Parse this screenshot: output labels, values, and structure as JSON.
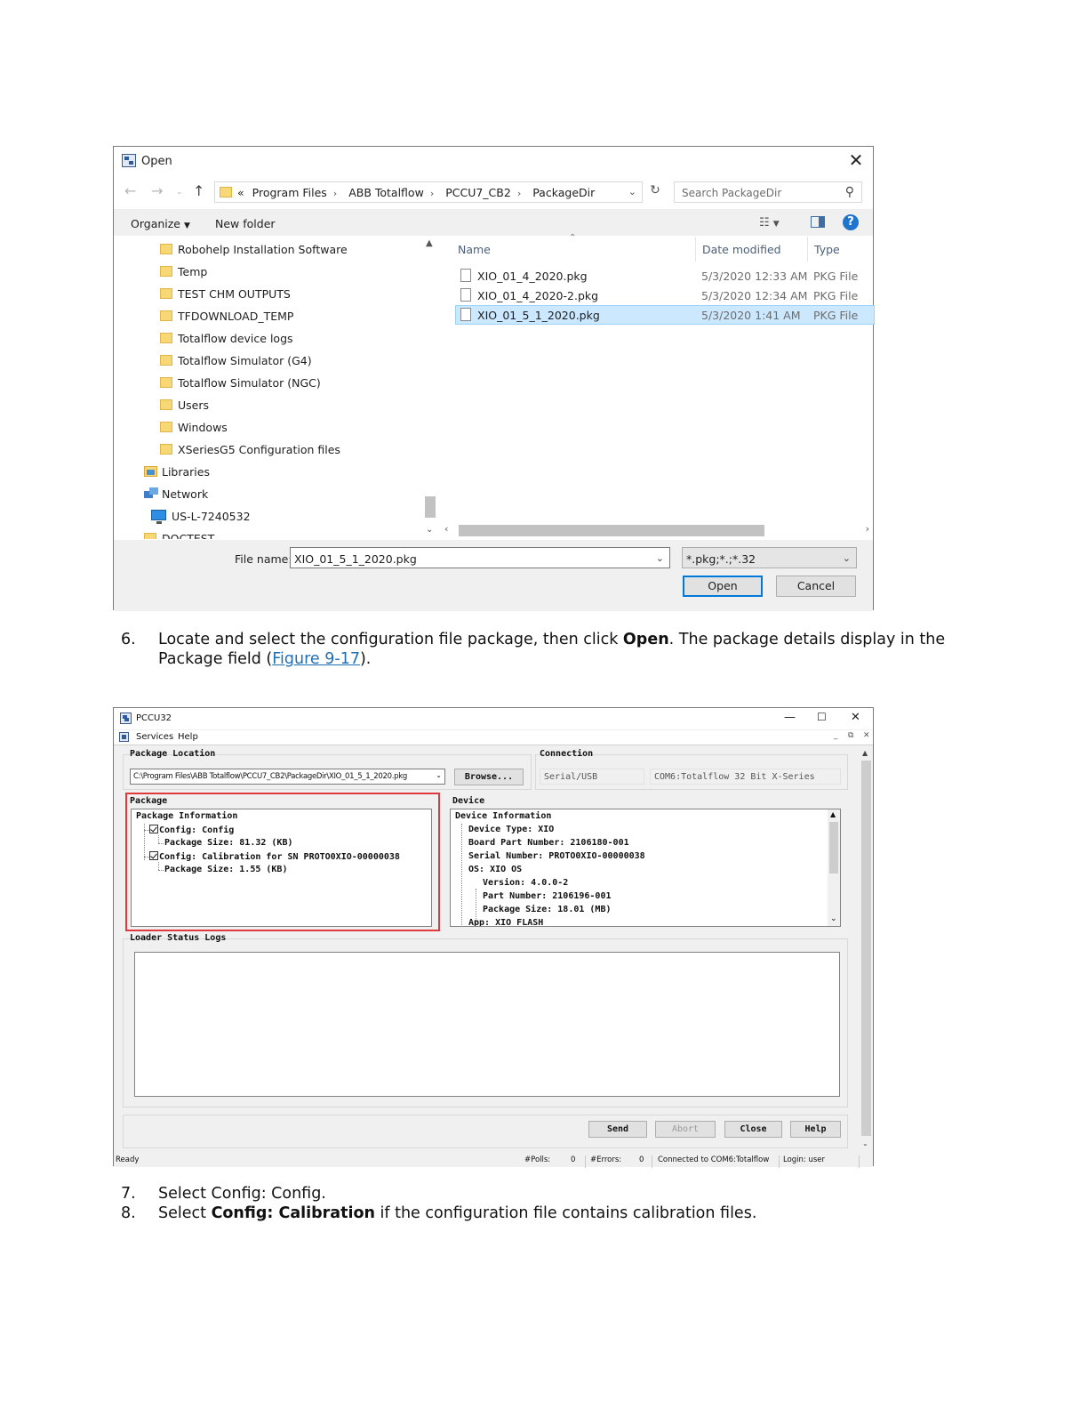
{
  "open_dialog": {
    "title": "Open",
    "address_crumbs": [
      "«",
      "Program Files",
      "ABB Totalflow",
      "PCCU7_CB2",
      "PackageDir"
    ],
    "search_placeholder": "Search PackageDir",
    "toolbar": {
      "organize": "Organize",
      "new_folder": "New folder"
    },
    "nav_items": [
      "Robohelp Installation Software",
      "Temp",
      "TEST CHM OUTPUTS",
      "TFDOWNLOAD_TEMP",
      "Totalflow device logs",
      "Totalflow Simulator (G4)",
      "Totalflow Simulator (NGC)",
      "Users",
      "Windows",
      "XSeriesG5 Configuration files"
    ],
    "nav_libraries": "Libraries",
    "nav_network": "Network",
    "nav_computer": "US-L-7240532",
    "nav_partial": "DOCTEST",
    "columns": {
      "name": "Name",
      "date": "Date modified",
      "type": "Type"
    },
    "files": [
      {
        "name": "XIO_01_4_2020.pkg",
        "date": "5/3/2020 12:33 AM",
        "type": "PKG File"
      },
      {
        "name": "XIO_01_4_2020-2.pkg",
        "date": "5/3/2020 12:34 AM",
        "type": "PKG File"
      },
      {
        "name": "XIO_01_5_1_2020.pkg",
        "date": "5/3/2020 1:41 AM",
        "type": "PKG File"
      }
    ],
    "file_name_label": "File name:",
    "file_name_value": "XIO_01_5_1_2020.pkg",
    "filter_value": "*.pkg;*.;*.32",
    "open_button": "Open",
    "cancel_button": "Cancel"
  },
  "step6": {
    "num": "6.",
    "text_a": "Locate and select the configuration file package, then click ",
    "bold": "Open",
    "text_b": ". The package details display in the",
    "line2_a": "Package field (",
    "link": "Figure 9-17",
    "line2_b": ")."
  },
  "pccu": {
    "title": "PCCU32",
    "menu": [
      "Services",
      "Help"
    ],
    "package_location_label": "Package Location",
    "package_path": "C:\\Program Files\\ABB Totalflow\\PCCU7_CB2\\PackageDir\\XIO_01_5_1_2020.pkg",
    "browse_button": "Browse...",
    "connection_label": "Connection",
    "connection_type": "Serial/USB",
    "connection_port": "COM6:Totalflow 32 Bit X-Series",
    "package_label": "Package",
    "package_tree": {
      "root": "Package Information",
      "items": [
        "Config: Config",
        "Package Size: 81.32 (KB)",
        "Config: Calibration for SN PROTO0XIO-00000038",
        "Package Size: 1.55 (KB)"
      ]
    },
    "device_label": "Device",
    "device_tree": {
      "root": "Device Information",
      "items": [
        "Device Type: XIO",
        "Board Part Number: 2106180-001",
        "Serial Number: PROTO0XIO-00000038",
        "OS: XIO OS",
        "Version: 4.0.0-2",
        "Part Number: 2106196-001",
        "Package Size: 18.01 (MB)",
        "App: XIO_FLASH"
      ]
    },
    "loader_status_label": "Loader Status Logs",
    "buttons": {
      "send": "Send",
      "abort": "Abort",
      "close": "Close",
      "help": "Help"
    },
    "status": {
      "ready": "Ready",
      "polls_label": "#Polls:",
      "polls": "0",
      "errors_label": "#Errors:",
      "errors": "0",
      "connected": "Connected to COM6:Totalflow",
      "login": "Login: user"
    }
  },
  "step7": {
    "num": "7.",
    "text": "Select Config: Config."
  },
  "step8": {
    "num": "8.",
    "text_a": "Select ",
    "bold": "Config: Calibration",
    "text_b": " if the configuration file contains calibration files."
  }
}
